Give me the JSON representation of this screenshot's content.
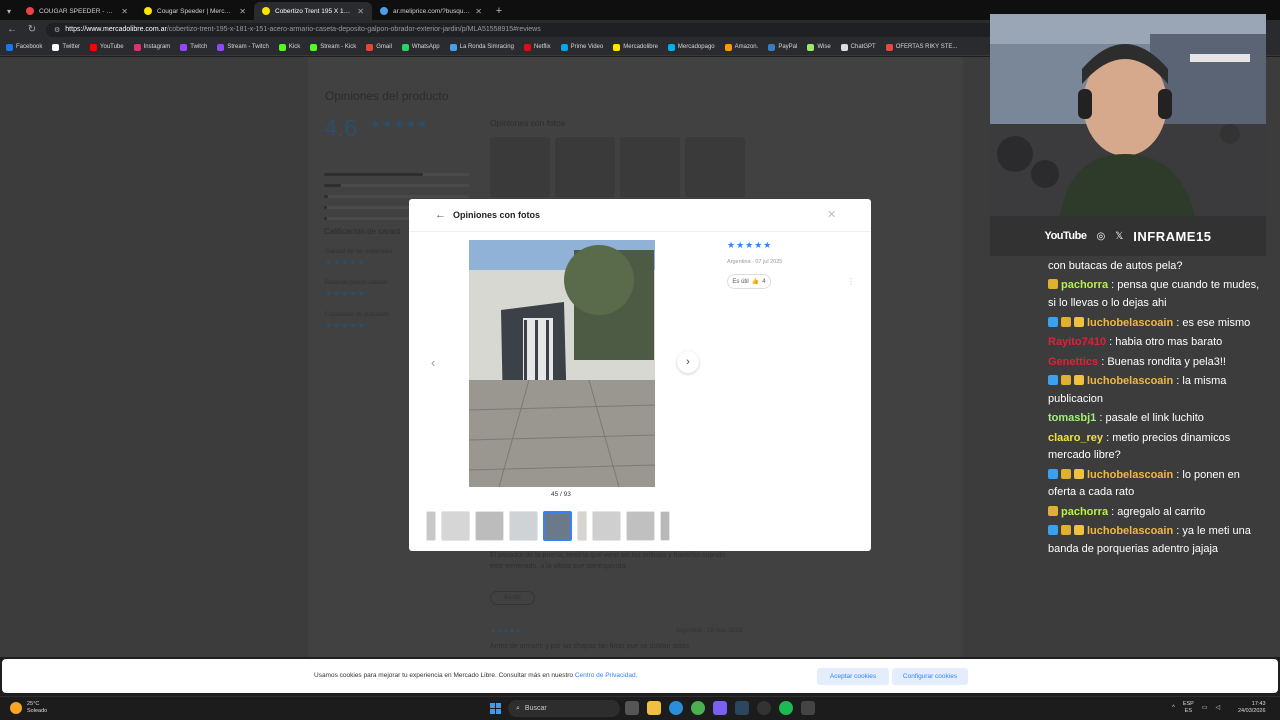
{
  "browser": {
    "tabs": [
      {
        "label": "COUGAR SPEEDER - Ergonomic G",
        "color": "#e84545"
      },
      {
        "label": "Cougar Speeder | MercadoLibre",
        "color": "#ffe600"
      },
      {
        "label": "Cobertizo Trent 195 X 181 X 151 A",
        "color": "#ffe600",
        "active": true
      },
      {
        "label": "ar.meliprice.com/?busqueda=Cob",
        "color": "#4aa0e8"
      }
    ],
    "url_host": "https://www.mercadolibre.com.ar",
    "url_path": "/cobertizo-trent-195-x-181-x-151-acero-armario-caseta-deposito-galpon-obrador-exterior-jardin/p/MLA51558915#reviews",
    "bookmarks": [
      {
        "label": "Facebook",
        "color": "#1877f2"
      },
      {
        "label": "Twitter",
        "color": "#ffffff"
      },
      {
        "label": "YouTube",
        "color": "#ff0000"
      },
      {
        "label": "Instagram",
        "color": "#e1306c"
      },
      {
        "label": "Twitch",
        "color": "#9146ff"
      },
      {
        "label": "Stream - Twitch",
        "color": "#9146ff"
      },
      {
        "label": "Kick",
        "color": "#53fc18"
      },
      {
        "label": "Stream - Kick",
        "color": "#53fc18"
      },
      {
        "label": "Gmail",
        "color": "#ea4335"
      },
      {
        "label": "WhatsApp",
        "color": "#25d366"
      },
      {
        "label": "La Ronda Simracing",
        "color": "#4aa0e8"
      },
      {
        "label": "Netflix",
        "color": "#e50914"
      },
      {
        "label": "Prime Video",
        "color": "#00a8e1"
      },
      {
        "label": "Mercadolibre",
        "color": "#ffe600"
      },
      {
        "label": "Mercadopago",
        "color": "#00b1ea"
      },
      {
        "label": "Amazon.",
        "color": "#ff9900"
      },
      {
        "label": "PayPal",
        "color": "#3b7bbf"
      },
      {
        "label": "Wise",
        "color": "#9fe870"
      },
      {
        "label": "ChatGPT",
        "color": "#dddddd"
      },
      {
        "label": "OFERTAS RIKY STE...",
        "color": "#e84545"
      }
    ]
  },
  "page": {
    "section_title": "Opiniones del producto",
    "avg_rating": "4.6",
    "stars": "★★★★★",
    "calif_title": "Calificacion de caract",
    "criteria": [
      "Calidad de los materiales",
      "Relación precio-calidad",
      "Capacidad de guardado"
    ],
    "fotos_title": "Opiniones con fotos",
    "review_text": "El pasador de la puerta, tendría que venir sin los orificios y hacerlos cuando este terminado, a la altura que corresponda.",
    "review_util": "Es útil",
    "review2_meta": "Argentina · 19 mar. 2025",
    "review2_text": "Antes de armarlo y por las chapas tan finas que se doblan solas"
  },
  "modal": {
    "title": "Opiniones con fotos",
    "counter": "45 / 93",
    "stars": "★★★★★",
    "meta": "Argentina · 07 jul 2025",
    "util_label": "Es útil",
    "util_count": "4"
  },
  "cookies": {
    "text": "Usamos cookies para mejorar tu experiencia en Mercado Libre. Consultar más en nuestro",
    "link": "Centro de Privacidad.",
    "accept": "Aceptar cookies",
    "config": "Configurar cookies"
  },
  "taskbar": {
    "temp": "25°C",
    "weather": "Soleado",
    "search": "Buscar",
    "lang1": "ESP",
    "lang2": "ES",
    "time": "17:43",
    "date": "24/03/2026"
  },
  "stream": {
    "platform": "YouTube",
    "handle": "INFRAME15"
  },
  "chat": [
    {
      "user": "",
      "color": "#ffffff",
      "text": "con butacas de autos pela?",
      "badges": []
    },
    {
      "user": "pachorra",
      "color": "#b8f04a",
      "text": ": pensa que cuando te mudes, si lo llevas o lo dejas ahi",
      "badges": [
        "#e0b030"
      ]
    },
    {
      "user": "luchobelascoain",
      "color": "#f0b840",
      "text": ": es ese mismo",
      "badges": [
        "#3aa0f0",
        "#e0b030",
        "#f0c040"
      ]
    },
    {
      "user": "Rayito7410",
      "color": "#e0203a",
      "text": ": habia otro mas barato",
      "badges": []
    },
    {
      "user": "Genettics",
      "color": "#e0203a",
      "text": ": Buenas rondita y pela3!!",
      "badges": []
    },
    {
      "user": "luchobelascoain",
      "color": "#f0b840",
      "text": ": la misma publicacion",
      "badges": [
        "#3aa0f0",
        "#e0b030",
        "#f0c040"
      ]
    },
    {
      "user": "tomasbj1",
      "color": "#9ef07a",
      "text": ": pasale el link luchito",
      "badges": []
    },
    {
      "user": "claaro_rey",
      "color": "#f0e040",
      "text": ": metio precios dinamicos mercado libre?",
      "badges": []
    },
    {
      "user": "luchobelascoain",
      "color": "#f0b840",
      "text": ": lo ponen en oferta a cada rato",
      "badges": [
        "#3aa0f0",
        "#e0b030",
        "#f0c040"
      ]
    },
    {
      "user": "pachorra",
      "color": "#b8f04a",
      "text": ": agregalo al carrito",
      "badges": [
        "#e0b030"
      ]
    },
    {
      "user": "luchobelascoain",
      "color": "#f0b840",
      "text": ": ya le meti una banda de porquerias adentro jajaja",
      "badges": [
        "#3aa0f0",
        "#e0b030",
        "#f0c040"
      ]
    }
  ]
}
